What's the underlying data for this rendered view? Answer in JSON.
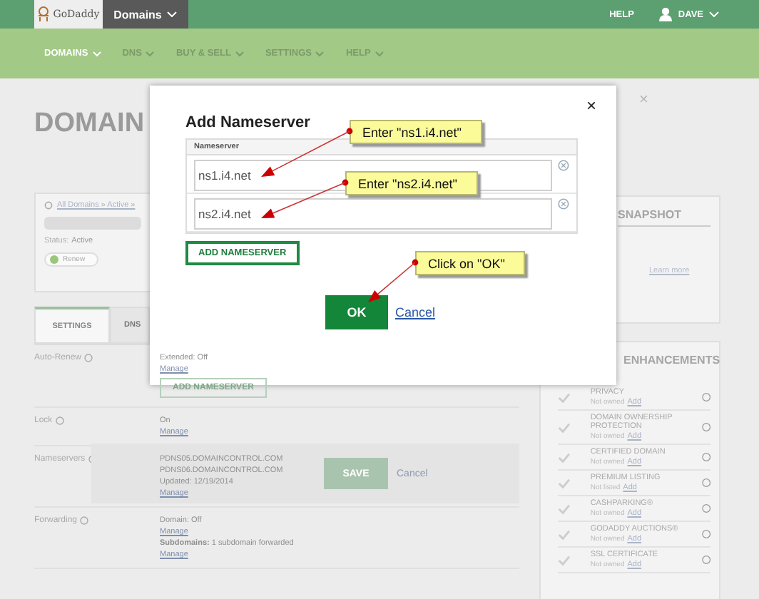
{
  "top_bar": {
    "logo": "GoDaddy",
    "product_menu": "Domains",
    "help": "HELP",
    "user": "DAVE"
  },
  "nav": [
    {
      "label": "DOMAINS",
      "selected": true
    },
    {
      "label": "DNS",
      "selected": false
    },
    {
      "label": "BUY & SELL",
      "selected": false
    },
    {
      "label": "SETTINGS",
      "selected": false
    },
    {
      "label": "HELP",
      "selected": false
    }
  ],
  "page": {
    "title": "DOMAIN",
    "close": "×",
    "breadcrumb": "All Domains » Active »",
    "status_label": "Status:",
    "status": "Active",
    "renew_button": "Renew",
    "tabs": [
      {
        "label": "SETTINGS",
        "selected": true
      },
      {
        "label": "DNS",
        "selected": false
      }
    ],
    "settings": [
      {
        "label": "Auto-Renew",
        "lines": [
          {
            "kind": "text",
            "text": "Extended: Off"
          },
          {
            "kind": "link",
            "text": "Manage"
          }
        ]
      },
      {
        "label": "Lock",
        "lines": [
          {
            "kind": "text",
            "text": "On"
          },
          {
            "kind": "link",
            "text": "Manage"
          }
        ]
      },
      {
        "label": "Nameservers",
        "lines": [
          {
            "kind": "text",
            "text": "PDNS05.DOMAINCONTROL.COM"
          },
          {
            "kind": "text",
            "text": "PDNS06.DOMAINCONTROL.COM"
          },
          {
            "kind": "text",
            "text": "Updated: 12/19/2014"
          },
          {
            "kind": "link",
            "text": "Manage"
          }
        ]
      },
      {
        "label": "Forwarding",
        "lines": [
          {
            "kind": "text",
            "text": "Domain: Off"
          },
          {
            "kind": "link",
            "text": "Manage"
          },
          {
            "kind": "text",
            "text": "**Subdomains:** 1 subdomain forwarded"
          },
          {
            "kind": "link",
            "text": "Manage"
          }
        ]
      }
    ],
    "ghost_button": "ADD NAMESERVER",
    "save_button": "SAVE",
    "cancel_link": "Cancel"
  },
  "snapshot": {
    "title": "SNAPSHOT",
    "link": "Learn more"
  },
  "enhancements": {
    "title": "ENHANCEMENTS",
    "items": [
      {
        "name": "PRIVACY",
        "status": "Not owned",
        "action": "Add"
      },
      {
        "name": "DOMAIN OWNERSHIP PROTECTION",
        "status": "Not owned",
        "action": "Add"
      },
      {
        "name": "CERTIFIED DOMAIN",
        "status": "Not owned",
        "action": "Add"
      },
      {
        "name": "PREMIUM LISTING",
        "status": "Not listed",
        "action": "Add"
      },
      {
        "name": "CASHPARKING®",
        "status": "Not owned",
        "action": "Add"
      },
      {
        "name": "GODADDY AUCTIONS®",
        "status": "Not owned",
        "action": "Add"
      },
      {
        "name": "SSL CERTIFICATE",
        "status": "Not owned",
        "action": "Add"
      }
    ]
  },
  "dialog": {
    "title": "Add Nameserver",
    "close": "×",
    "column_header": "Nameserver",
    "fields": [
      {
        "value": "ns1.i4.net"
      },
      {
        "value": "ns2.i4.net"
      }
    ],
    "add_button": "ADD NAMESERVER",
    "ok_button": "OK",
    "cancel_link": "Cancel"
  },
  "callouts": [
    {
      "text": "Enter \"ns1.i4.net\""
    },
    {
      "text": "Enter \"ns2.i4.net\""
    },
    {
      "text": "Click on \"OK\""
    }
  ]
}
